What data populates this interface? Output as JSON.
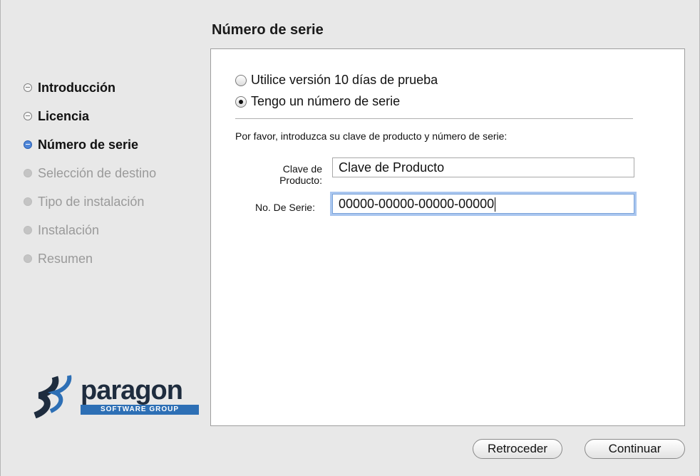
{
  "page_title": "Número de serie",
  "steps": [
    {
      "label": "Introducción",
      "state": "done"
    },
    {
      "label": "Licencia",
      "state": "done"
    },
    {
      "label": "Número de serie",
      "state": "current"
    },
    {
      "label": "Selección de destino",
      "state": "pending"
    },
    {
      "label": "Tipo de instalación",
      "state": "pending"
    },
    {
      "label": "Instalación",
      "state": "pending"
    },
    {
      "label": "Resumen",
      "state": "pending"
    }
  ],
  "logo": {
    "word": "paragon",
    "sub": "SOFTWARE GROUP"
  },
  "options": {
    "trial_label": "Utilice versión 10 días de prueba",
    "serial_label": "Tengo un número de serie",
    "selected": "serial"
  },
  "instruction": "Por favor, introduzca su clave de producto y número de serie:",
  "fields": {
    "product_key_label_1": "Clave de",
    "product_key_label_2": "Producto:",
    "product_key_value": "Clave de Producto",
    "serial_label": "No. De Serie:",
    "serial_value": "00000-00000-00000-00000"
  },
  "buttons": {
    "back": "Retroceder",
    "continue": "Continuar"
  },
  "colors": {
    "accent": "#4f86d8",
    "logo_blue": "#2d6fb5",
    "focus_ring": "#a9c6ef"
  }
}
